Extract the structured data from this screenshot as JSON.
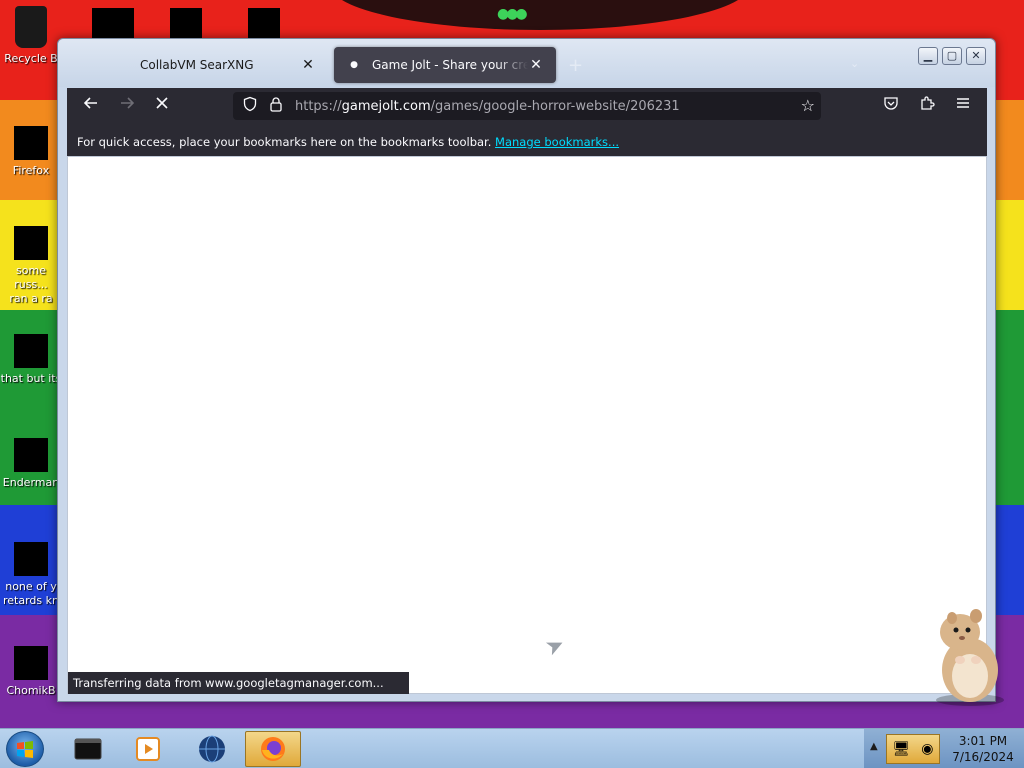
{
  "desktop": {
    "icons": [
      {
        "label": "Recycle B",
        "name": "recycle-bin"
      },
      {
        "label": "Firefox",
        "name": "firefox"
      },
      {
        "label": "some russ...\nran a ra",
        "name": "shortcut-1"
      },
      {
        "label": "that but its",
        "name": "shortcut-2"
      },
      {
        "label": "Enderman",
        "name": "enderman"
      },
      {
        "label": "none of y\nretards kn",
        "name": "shortcut-3"
      },
      {
        "label": "ChomikB",
        "name": "chomik"
      }
    ]
  },
  "browser": {
    "tabs": [
      {
        "title": "CollabVM SearXNG",
        "active": false
      },
      {
        "title": "Game Jolt - Share your creations",
        "active": true
      }
    ],
    "window_buttons": {
      "minimize": "▁",
      "maximize": "▢",
      "close": "✕"
    },
    "url": {
      "host": "gamejolt.com",
      "path": "/games/google-horror-website/206231"
    },
    "bookmarks_bar": {
      "message": "For quick access, place your bookmarks here on the bookmarks toolbar.",
      "link": "Manage bookmarks..."
    },
    "status": "Transferring data from www.googletagmanager.com...",
    "loading": true
  },
  "taskbar": {
    "clock_time": "3:01 PM",
    "clock_date": "7/16/2024",
    "items": [
      "terminal",
      "media-player",
      "globe",
      "firefox"
    ],
    "active_item": "firefox"
  },
  "colors": {
    "toolbar": "#2b2a33",
    "urlbar": "#1c1b22",
    "link": "#00ddff"
  }
}
